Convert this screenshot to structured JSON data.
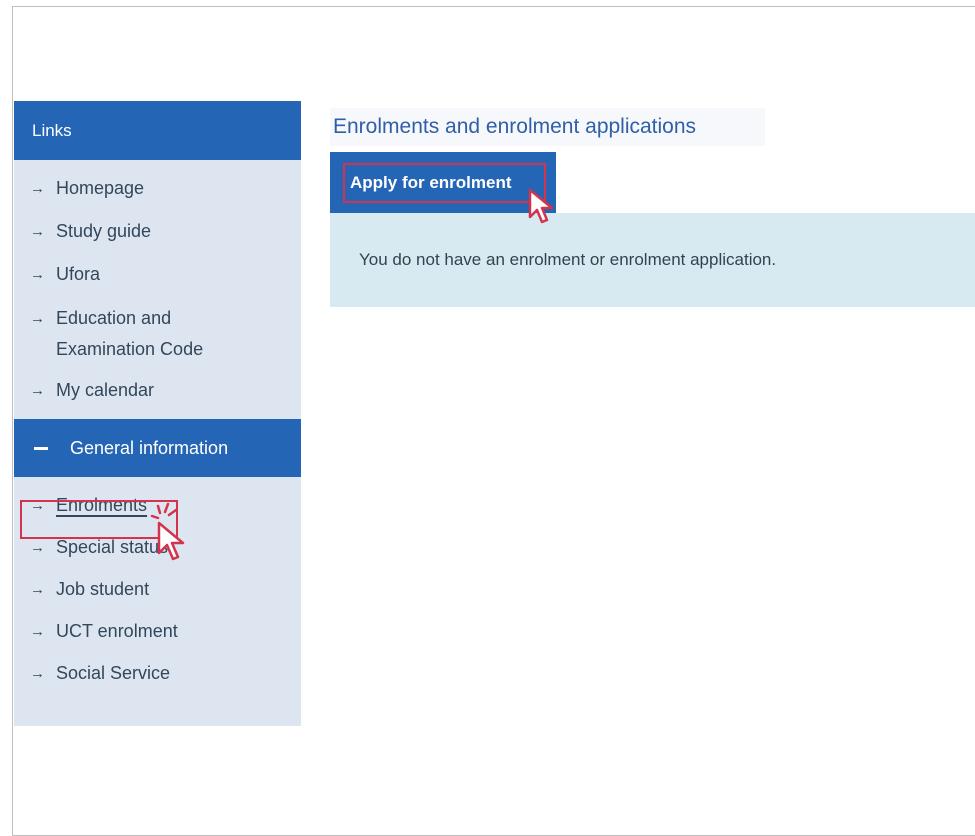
{
  "sidebar": {
    "header": "Links",
    "links": [
      {
        "label": "Homepage"
      },
      {
        "label": "Study guide"
      },
      {
        "label": "Ufora"
      },
      {
        "label": "Education and",
        "label2": "Examination Code"
      },
      {
        "label": "My calendar"
      }
    ],
    "group": {
      "label": "General information",
      "items": [
        {
          "label": "Enrolments"
        },
        {
          "label": "Special status"
        },
        {
          "label": "Job student"
        },
        {
          "label": "UCT enrolment"
        },
        {
          "label": "Social Service"
        }
      ]
    }
  },
  "main": {
    "title": "Enrolments and enrolment applications",
    "tab_label": "Apply for enrolment",
    "message": "You do not have an enrolment or enrolment application."
  },
  "icons": {
    "arrow": "right-arrow-icon",
    "group_toggle": "minus-icon",
    "pointer": "cursor-pointer-icon"
  },
  "colors": {
    "primary": "#2565b5",
    "sidebar_bg": "#dde6f0",
    "content_bg": "#d7eaf2",
    "highlight": "#d4334e"
  }
}
